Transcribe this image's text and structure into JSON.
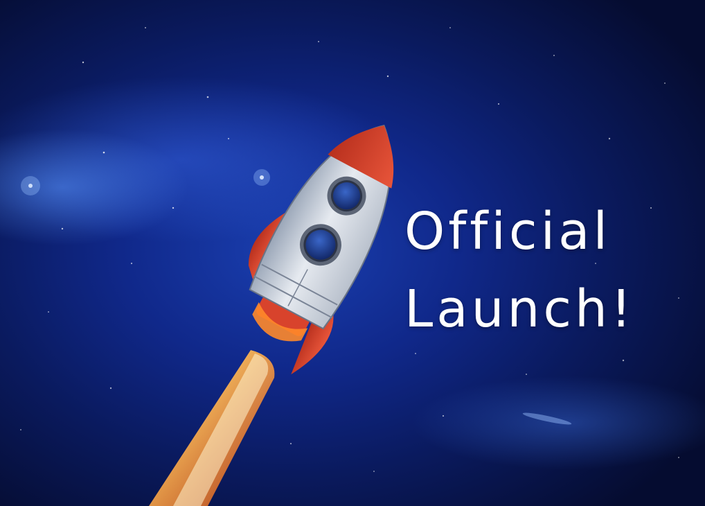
{
  "headline": {
    "line1": "Official",
    "line2": "Launch!"
  },
  "colors": {
    "space_dark": "#050c30",
    "space_mid": "#10288a",
    "space_glow": "#3c6ef0",
    "rocket_body": "#d8dde6",
    "rocket_red": "#d8432c",
    "window_blue": "#1c3a8a",
    "flame_core": "#fff1b8",
    "flame_outer": "#ff8a2a",
    "text": "#ffffff"
  },
  "icons": {
    "rocket": "rocket-icon"
  }
}
